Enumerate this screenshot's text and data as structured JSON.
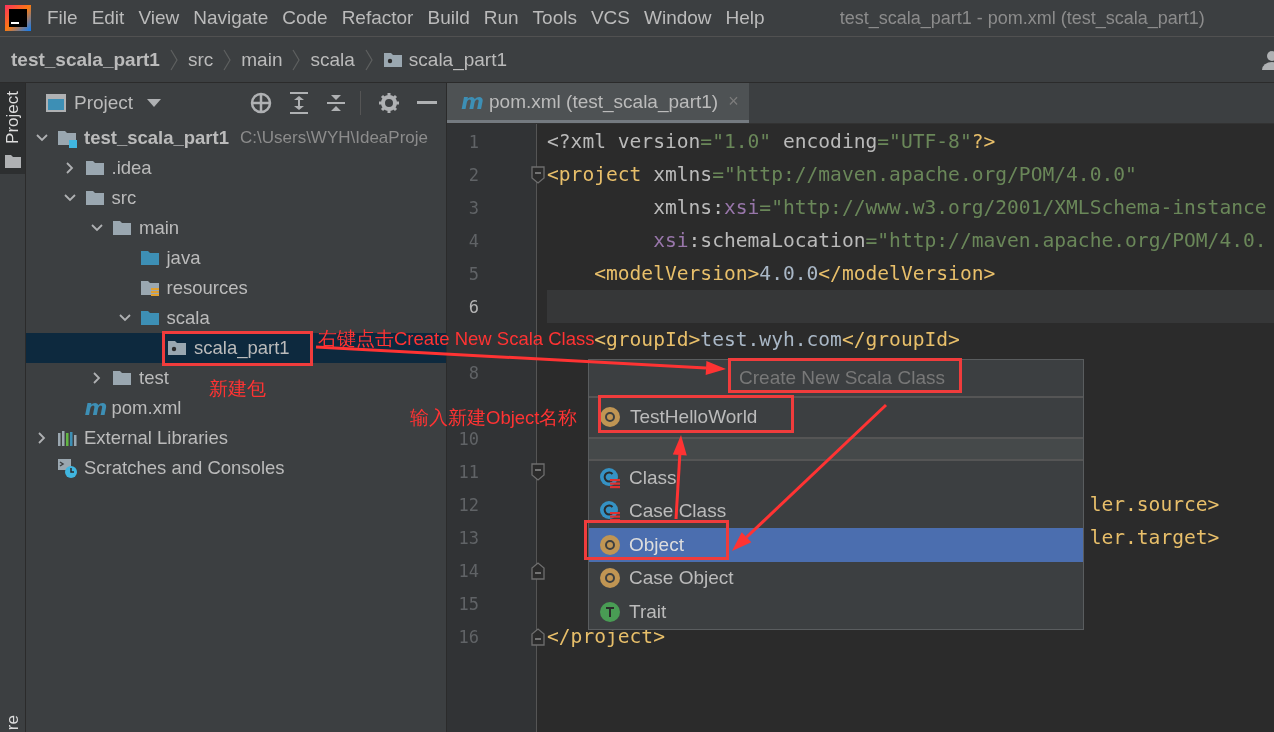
{
  "menu_bar": {
    "items": [
      "File",
      "Edit",
      "View",
      "Navigate",
      "Code",
      "Refactor",
      "Build",
      "Run",
      "Tools",
      "VCS",
      "Window",
      "Help"
    ],
    "window_title": "test_scala_part1 - pom.xml (test_scala_part1)"
  },
  "breadcrumbs": [
    {
      "text": "test_scala_part1",
      "kind": "module"
    },
    {
      "text": "src",
      "kind": "dir"
    },
    {
      "text": "main",
      "kind": "dir"
    },
    {
      "text": "scala",
      "kind": "dir"
    },
    {
      "text": "scala_part1",
      "kind": "package"
    }
  ],
  "tool_strip": {
    "top_tab": {
      "label": "Project",
      "selected": true
    },
    "bottom_tab": "re"
  },
  "project_panel": {
    "title": "Project",
    "tree": [
      {
        "label": "test_scala_part1",
        "kind": "module",
        "note": "C:\\Users\\WYH\\IdeaProje",
        "expanded": true,
        "selected": false,
        "children": [
          {
            "label": ".idea",
            "kind": "folder",
            "expanded": false,
            "selected": false
          },
          {
            "label": "src",
            "kind": "folder",
            "expanded": true,
            "selected": false,
            "children": [
              {
                "label": "main",
                "kind": "folder",
                "expanded": true,
                "selected": false,
                "children": [
                  {
                    "label": "java",
                    "kind": "source-folder",
                    "selected": false
                  },
                  {
                    "label": "resources",
                    "kind": "resources",
                    "selected": false
                  },
                  {
                    "label": "scala",
                    "kind": "source-folder",
                    "expanded": true,
                    "selected": false,
                    "children": [
                      {
                        "label": "scala_part1",
                        "kind": "package",
                        "selected": true
                      }
                    ]
                  }
                ]
              },
              {
                "label": "test",
                "kind": "folder",
                "expanded": false,
                "selected": false
              }
            ]
          },
          {
            "label": "pom.xml",
            "kind": "maven",
            "icon": "m",
            "selected": false
          }
        ]
      },
      {
        "label": "External Libraries",
        "kind": "libraries",
        "expanded": false,
        "selected": false
      },
      {
        "label": "Scratches and Consoles",
        "kind": "scratches",
        "selected": false
      }
    ]
  },
  "editor": {
    "tab": {
      "icon": "m",
      "label": "pom.xml (test_scala_part1)",
      "close": "×",
      "selected": true
    },
    "lines": [
      {
        "number": "1",
        "kind": "code",
        "current": false,
        "segments": [
          {
            "kind": "attr",
            "text": "<?xml version"
          },
          {
            "kind": "value",
            "text": "=\"1.0\""
          },
          {
            "kind": "attr",
            "text": " encoding"
          },
          {
            "kind": "value",
            "text": "=\"UTF-8\""
          },
          {
            "kind": "tag",
            "text": "?>"
          }
        ]
      },
      {
        "number": "2",
        "kind": "fold-start",
        "current": false,
        "segments": [
          {
            "kind": "tag",
            "text": "<project"
          },
          {
            "kind": "attr",
            "text": " xmlns"
          },
          {
            "kind": "value",
            "text": "=\"http://maven.apache.org/POM/4.0.0\""
          }
        ]
      },
      {
        "number": "3",
        "kind": "code",
        "current": false,
        "segments": [
          {
            "kind": "attr",
            "text": "         xmlns:"
          },
          {
            "kind": "ns",
            "text": "xsi"
          },
          {
            "kind": "value",
            "text": "=\"http://www.w3.org/2001/XMLSchema-instance"
          }
        ]
      },
      {
        "number": "4",
        "kind": "code",
        "current": false,
        "segments": [
          {
            "kind": "ns",
            "text": "         xsi"
          },
          {
            "kind": "attr",
            "text": ":schemaLocation"
          },
          {
            "kind": "value",
            "text": "=\"http://maven.apache.org/POM/4.0."
          }
        ]
      },
      {
        "number": "5",
        "kind": "code",
        "current": false,
        "segments": [
          {
            "kind": "tag",
            "text": "    <modelVersion>"
          },
          {
            "kind": "plain",
            "text": "4.0.0"
          },
          {
            "kind": "tag",
            "text": "</modelVersion>"
          }
        ]
      },
      {
        "number": "6",
        "kind": "code",
        "current": true
      },
      {
        "kind": "code",
        "current": false,
        "segments": [
          {
            "kind": "tag",
            "text": "    <groupId>"
          },
          {
            "kind": "plain",
            "text": "test.wyh.com"
          },
          {
            "kind": "tag",
            "text": "</groupId>"
          }
        ]
      },
      {
        "number": "8",
        "kind": "code",
        "current": false
      },
      {
        "kind": "code",
        "current": false
      },
      {
        "number": "10",
        "kind": "code",
        "current": false
      },
      {
        "number": "11",
        "kind": "fold-start",
        "current": false
      },
      {
        "number": "12",
        "kind": "code",
        "current": false,
        "segments": [
          {
            "kind": "tag",
            "text": "                                              ler.source>"
          }
        ]
      },
      {
        "number": "13",
        "kind": "code",
        "current": false,
        "segments": [
          {
            "kind": "tag",
            "text": "                                              ler.target>"
          }
        ]
      },
      {
        "number": "14",
        "kind": "fold-end",
        "current": false
      },
      {
        "number": "15",
        "kind": "code",
        "current": false
      },
      {
        "number": "16",
        "kind": "fold-end",
        "current": false,
        "segments": [
          {
            "kind": "tag",
            "text": "</project>"
          }
        ]
      }
    ]
  },
  "popup": {
    "title": "Create New Scala Class",
    "input": {
      "value": "TestHelloWorld",
      "kind": "object"
    },
    "items": [
      {
        "label": "Class",
        "kind": "class",
        "selected": false
      },
      {
        "label": "Case Class",
        "kind": "case-class",
        "selected": false
      },
      {
        "label": "Object",
        "kind": "object",
        "selected": true
      },
      {
        "label": "Case Object",
        "kind": "case-object",
        "selected": false
      },
      {
        "label": "Trait",
        "kind": "trait",
        "selected": false
      }
    ]
  },
  "annotations": [
    {
      "text": "右键点击Create New Scala Class"
    },
    {
      "text": "新建包"
    },
    {
      "text": "输入新建Object名称"
    }
  ]
}
